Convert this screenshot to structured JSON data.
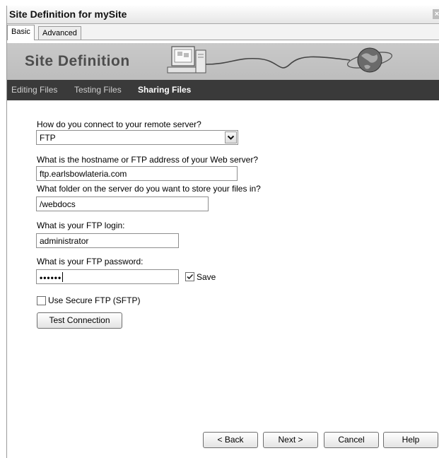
{
  "window": {
    "title": "Site Definition for mySite",
    "close_glyph": "×"
  },
  "tabs": [
    {
      "label": "Basic",
      "active": true
    },
    {
      "label": "Advanced",
      "active": false
    }
  ],
  "banner": {
    "title": "Site Definition"
  },
  "steps": [
    {
      "label": "Editing Files",
      "active": false
    },
    {
      "label": "Testing Files",
      "active": false
    },
    {
      "label": "Sharing Files",
      "active": true
    }
  ],
  "form": {
    "connect_label": "How do you connect to your remote server?",
    "connect_value": "FTP",
    "host_label": "What is the hostname or FTP address of your Web server?",
    "host_value": "ftp.earlsbowlateria.com",
    "folder_label": "What folder on the server do you want to store your files in?",
    "folder_value": "/webdocs",
    "login_label": "What is your FTP login:",
    "login_value": "administrator",
    "password_label": "What is your FTP password:",
    "password_value": "••••••",
    "save_label": "Save",
    "save_checked": true,
    "sftp_label": "Use Secure FTP (SFTP)",
    "sftp_checked": false,
    "test_button": "Test Connection"
  },
  "footer": {
    "back": "< Back",
    "next": "Next >",
    "cancel": "Cancel",
    "help": "Help"
  },
  "icons": {
    "close": "close-icon",
    "dropdown": "chevron-down-icon",
    "checkmark": "check-icon",
    "computer": "computer-icon",
    "globe": "globe-icon"
  }
}
